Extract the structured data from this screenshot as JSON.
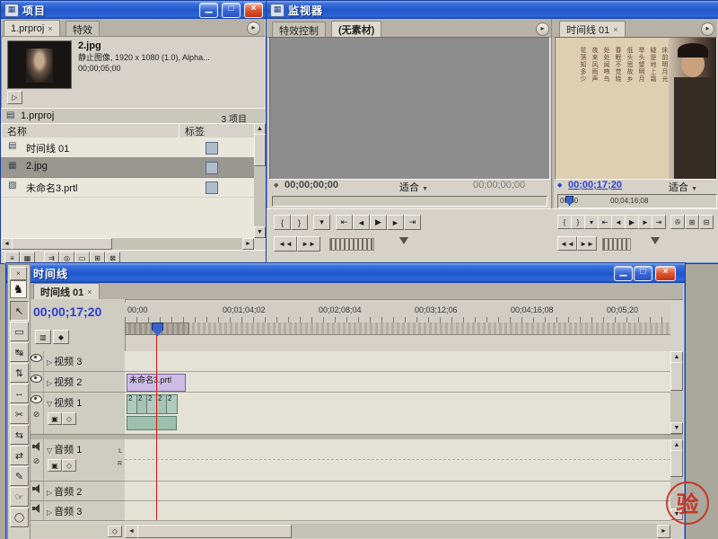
{
  "icons": {
    "window": "▦",
    "minimize": "▁",
    "maximize": "□",
    "close": "×",
    "tab_close": "×",
    "panel_menu": "▸",
    "play": "▷",
    "bin": "▤",
    "sequence": "▤",
    "image": "▦",
    "title_file": "▧",
    "dropdown": "▼",
    "tc_marker": "◆",
    "collapsed": "▷",
    "expanded": "▽",
    "display_style": "▣",
    "keyframes": "◇",
    "toggle_off": "⊘",
    "snap": "▥",
    "marker_btn": "◆",
    "up": "▲",
    "down": "▼",
    "left": "◄",
    "right": "►",
    "horse": "♞"
  },
  "project": {
    "title": "项目",
    "tab_project": "1.prproj",
    "tab_effects": "特效",
    "preview": {
      "filename": "2.jpg",
      "details": "静止图像, 1920 x 1080 (1.0), Alpha...",
      "duration": "00;00;05;00"
    },
    "bin_name": "1.prproj",
    "item_count": "3 项目",
    "col_name": "名称",
    "col_label": "标签",
    "items": [
      {
        "name": "时间线 01"
      },
      {
        "name": "2.jpg"
      },
      {
        "name": "未命名3.prtl"
      }
    ],
    "footer_icons": [
      "≡",
      "▦",
      "⇉",
      "◎",
      "▭",
      "⊞",
      "⊠"
    ]
  },
  "monitor": {
    "title": "监视器",
    "source": {
      "tab_effects": "特效控制",
      "tab_clip": "(无素材)",
      "current_time": "00;00;00;00",
      "zoom": "适合",
      "duration": "00;00;00;00"
    },
    "program": {
      "tab": "时间线 01",
      "current_time": "00;00;17;20",
      "zoom": "适合",
      "ruler_start": "00;00",
      "ruler_end": "00;04;16;08",
      "poem": [
        "床前明月光",
        "疑是地上霜",
        "举头望明月",
        "低头思故乡",
        "春眠不觉晓",
        "处处闻啼鸟",
        "夜来风雨声",
        "花落知多少"
      ]
    },
    "transport": {
      "row1": [
        "{",
        "}",
        "▾",
        "⇤",
        "◄",
        "▶",
        "►",
        "⇥"
      ],
      "row2": [
        "◄◄",
        "►►"
      ],
      "extra": [
        "✇",
        "⊞",
        "⊟"
      ]
    }
  },
  "timeline": {
    "title": "时间线",
    "tab": "时间线 01",
    "timecode": "00;00;17;20",
    "ruler": [
      "00;00",
      "00;01;04;02",
      "00;02;08;04",
      "00;03;12;06",
      "00;04;16;08",
      "00;05;20"
    ],
    "tracks": {
      "video3": "视频 3",
      "video2": "视频 2",
      "video1": "视频 1",
      "audio1": "音频 1",
      "audio2": "音频 2",
      "audio3": "音频 3"
    },
    "clips": {
      "video2_clip": "未命名3.prtl",
      "video1_clips": [
        "2",
        "2",
        "2",
        "2",
        "2"
      ]
    },
    "channel_left": "L",
    "channel_right": "R"
  },
  "tools": [
    {
      "name": "selection-tool",
      "glyph": "↖"
    },
    {
      "name": "track-select-tool",
      "glyph": "▭"
    },
    {
      "name": "ripple-edit-tool",
      "glyph": "↹"
    },
    {
      "name": "rolling-edit-tool",
      "glyph": "⇅"
    },
    {
      "name": "rate-stretch-tool",
      "glyph": "↔"
    },
    {
      "name": "razor-tool",
      "glyph": "✂"
    },
    {
      "name": "slip-tool",
      "glyph": "⇆"
    },
    {
      "name": "slide-tool",
      "glyph": "⇄"
    },
    {
      "name": "pen-tool",
      "glyph": "✎"
    },
    {
      "name": "hand-tool",
      "glyph": "☞"
    },
    {
      "name": "zoom-tool",
      "glyph": "◯"
    }
  ],
  "watermark": "验"
}
